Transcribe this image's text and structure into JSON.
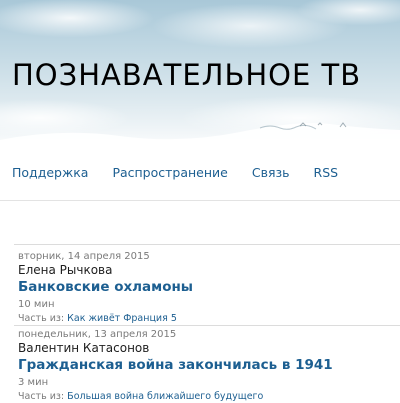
{
  "header": {
    "site_title": "ПОЗНАВАТЕЛЬНОЕ ТВ"
  },
  "nav": {
    "items": [
      {
        "label": "Поддержка"
      },
      {
        "label": "Распространение"
      },
      {
        "label": "Связь"
      },
      {
        "label": "RSS"
      }
    ]
  },
  "episodes": [
    {
      "date": "вторник, 14 апреля 2015",
      "author": "Елена Рычкова",
      "title": "Банковские охламоны",
      "duration": "10 мин",
      "part_prefix": "Часть из:",
      "series": "Как живёт Франция 5"
    },
    {
      "date": "понедельник, 13 апреля 2015",
      "author": "Валентин Катасонов",
      "title": "Гражданская война закончилась в 1941",
      "duration": "3 мин",
      "part_prefix": "Часть из:",
      "series": "Большая война ближайшего будущего"
    }
  ],
  "colors": {
    "link": "#1d5f91",
    "muted": "#7a7a7a",
    "sky": "#a9c8d8"
  }
}
